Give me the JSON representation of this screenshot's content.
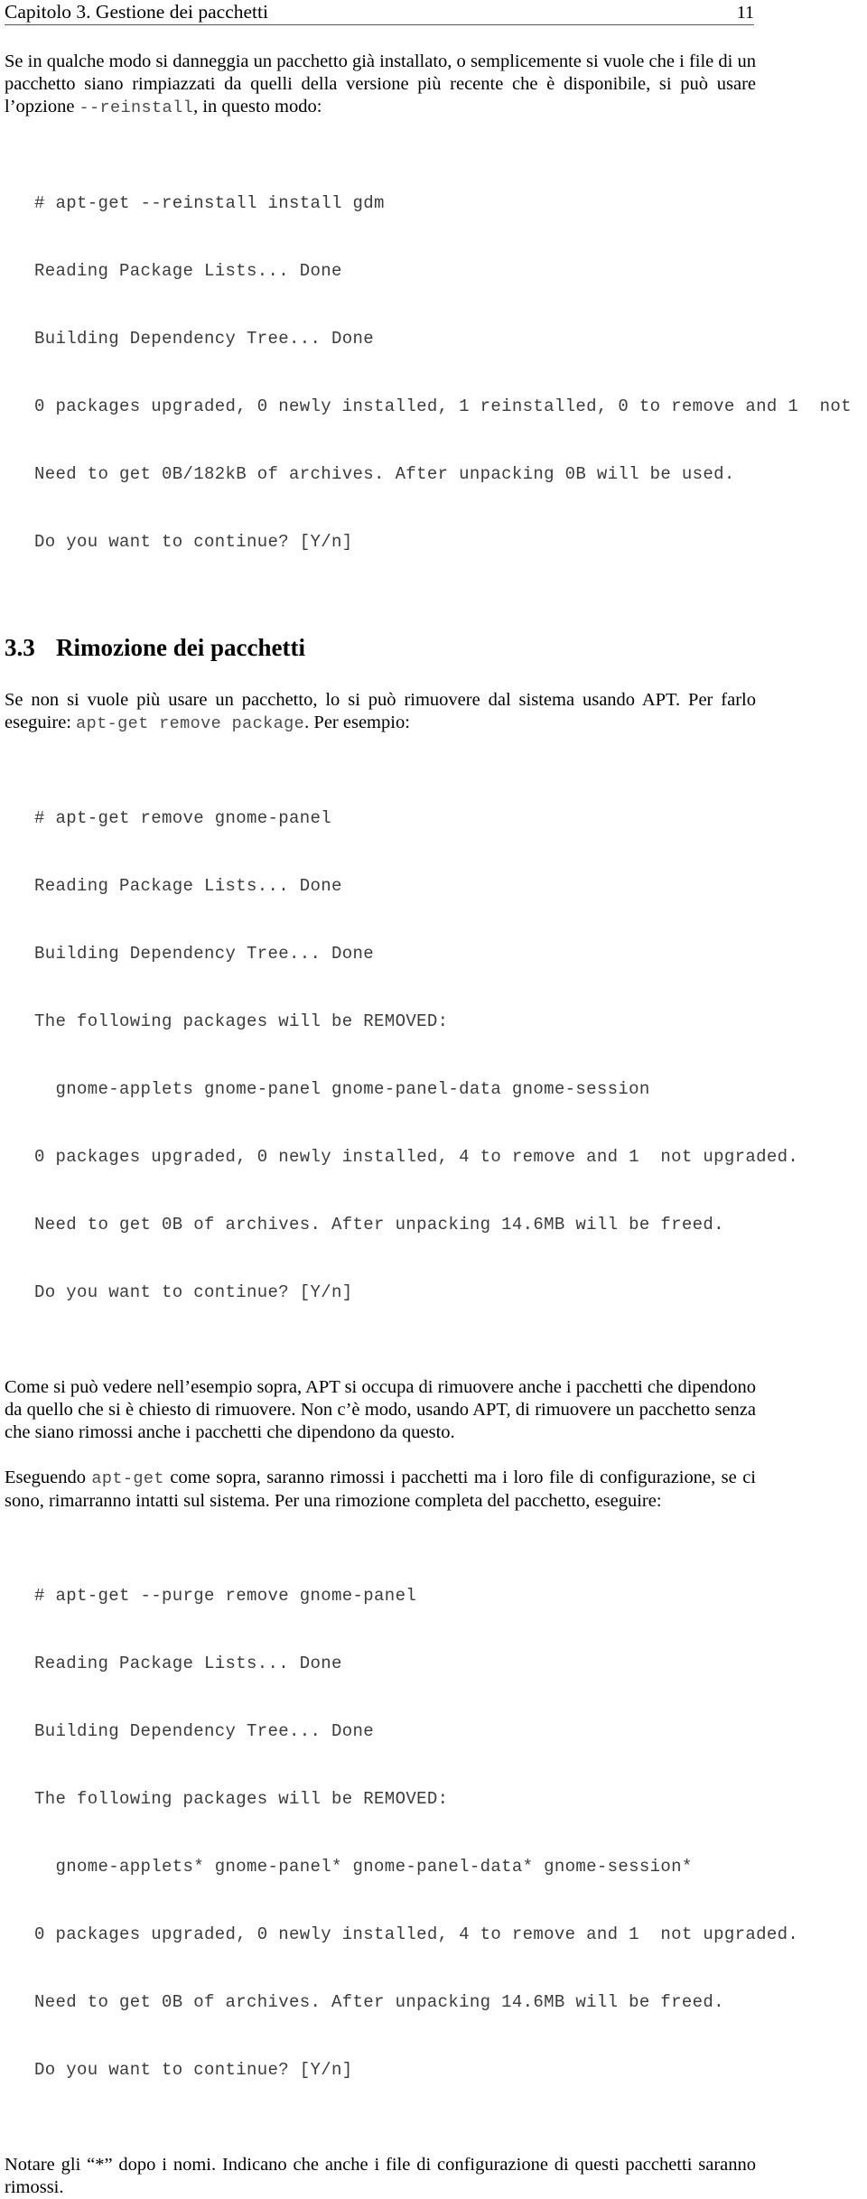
{
  "header": {
    "title": "Capitolo 3. Gestione dei pacchetti",
    "page_number": "11"
  },
  "paragraphs": {
    "intro_1": "Se in qualche modo si danneggia un pacchetto già installato, o semplicemente si vuole che i file di un pacchetto siano rimpiazzati da quelli della versione più recente che è disponibile, si può usare l’opzione ",
    "intro_1_code": "--reinstall",
    "intro_1_tail": ", in questo modo:",
    "sect33_lead_1": "Se non si vuole più usare un pacchetto, lo si può rimuovere dal sistema usando APT. Per farlo eseguire: ",
    "sect33_lead_code": "apt-get remove package",
    "sect33_lead_tail": ". Per esempio:",
    "after_remove": "Come si può vedere nell’esempio sopra, APT si occupa di rimuovere anche i pacchetti che dipendono da quello che si è chiesto di rimuovere. Non c’è modo, usando APT, di rimuovere un pacchetto senza che siano rimossi anche i pacchetti che dipendono da questo.",
    "purge_lead_head": "Eseguendo ",
    "purge_lead_code": "apt-get",
    "purge_lead_tail": " come sopra, saranno rimossi i pacchetti ma i loro file di configurazione, se ci sono, rimarranno intatti sul sistema. Per una rimozione completa del pacchetto, eseguire:",
    "closing": "Notare gli “*” dopo i nomi. Indicano che anche i file di configurazione di questi pacchetti saranno rimossi."
  },
  "section": {
    "number": "3.3",
    "title": "Rimozione dei pacchetti"
  },
  "code_blocks": {
    "reinstall": [
      "# apt-get --reinstall install gdm",
      "Reading Package Lists... Done",
      "Building Dependency Tree... Done",
      "0 packages upgraded, 0 newly installed, 1 reinstalled, 0 to remove and 1  not",
      "Need to get 0B/182kB of archives. After unpacking 0B will be used.",
      "Do you want to continue? [Y/n]"
    ],
    "remove": [
      "# apt-get remove gnome-panel",
      "Reading Package Lists... Done",
      "Building Dependency Tree... Done",
      "The following packages will be REMOVED:",
      "  gnome-applets gnome-panel gnome-panel-data gnome-session",
      "0 packages upgraded, 0 newly installed, 4 to remove and 1  not upgraded.",
      "Need to get 0B of archives. After unpacking 14.6MB will be freed.",
      "Do you want to continue? [Y/n]"
    ],
    "purge": [
      "# apt-get --purge remove gnome-panel",
      "Reading Package Lists... Done",
      "Building Dependency Tree... Done",
      "The following packages will be REMOVED:",
      "  gnome-applets* gnome-panel* gnome-panel-data* gnome-session*",
      "0 packages upgraded, 0 newly installed, 4 to remove and 1  not upgraded.",
      "Need to get 0B of archives. After unpacking 14.6MB will be freed.",
      "Do you want to continue? [Y/n]"
    ]
  },
  "colors": {
    "text": "#000000",
    "code_text": "#3b3b3b",
    "rule": "#555555",
    "page_background": "#ffffff"
  }
}
